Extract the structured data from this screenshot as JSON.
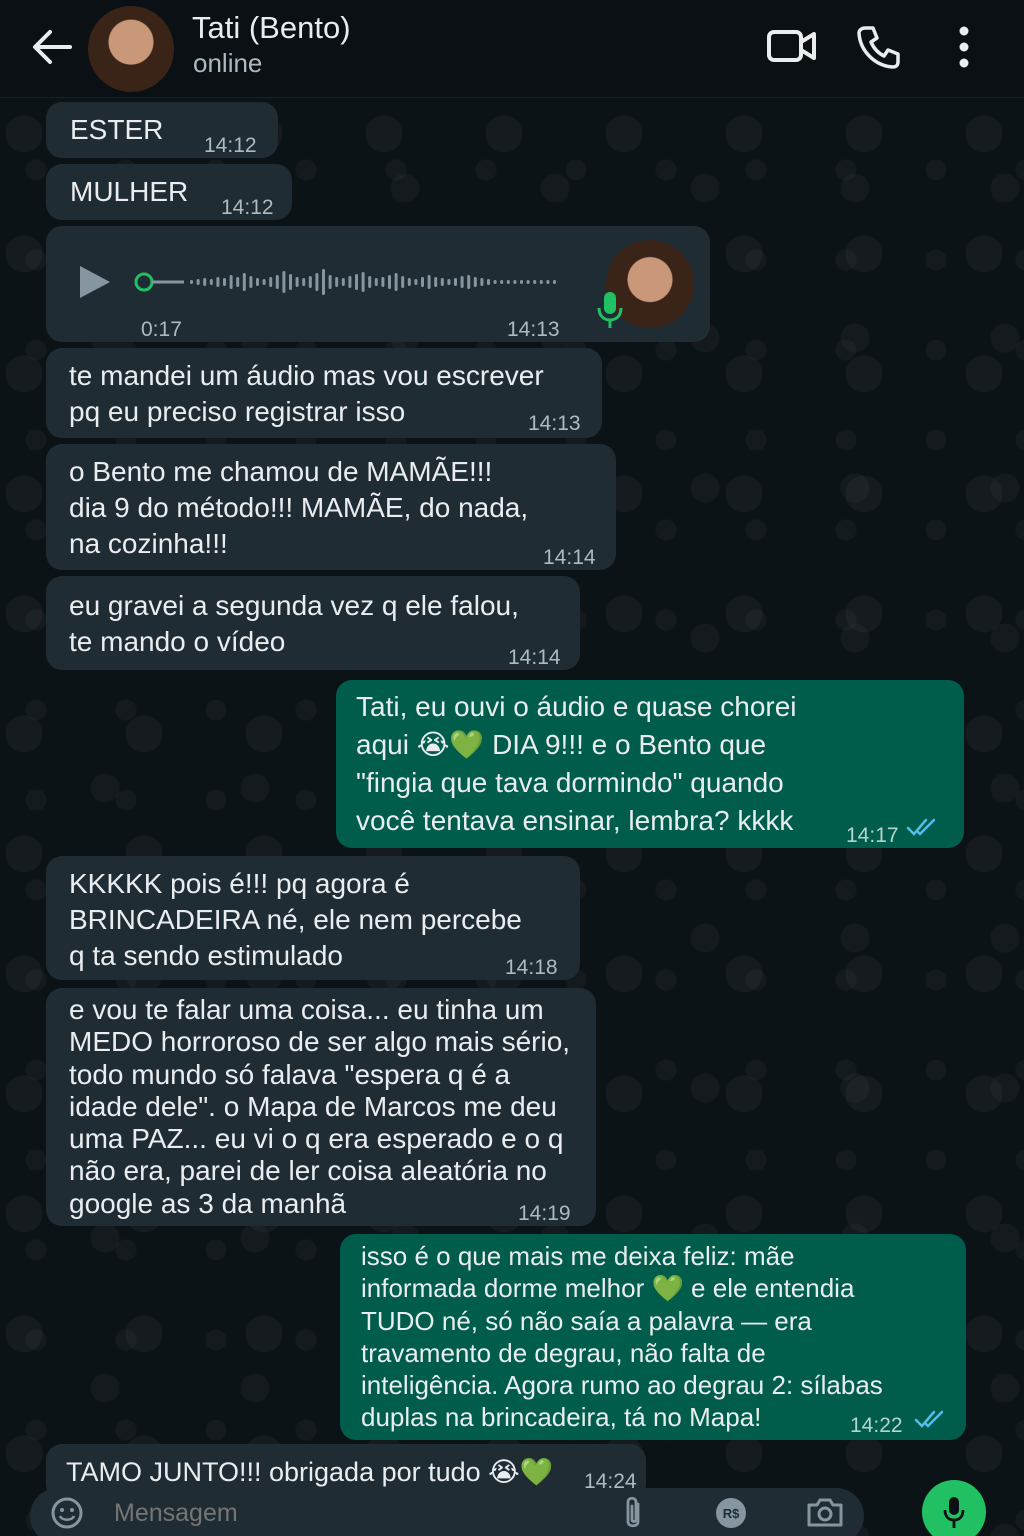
{
  "header": {
    "contact_name": "Tati (Bento)",
    "status": "online"
  },
  "messages": [
    {
      "dir": "in",
      "text": "ESTER",
      "time": "14:12"
    },
    {
      "dir": "in",
      "text": "MULHER",
      "time": "14:12"
    },
    {
      "dir": "in",
      "type": "audio",
      "duration": "0:17",
      "time": "14:13"
    },
    {
      "dir": "in",
      "text": "te mandei um áudio mas vou escrever\npq eu preciso registrar isso",
      "time": "14:13"
    },
    {
      "dir": "in",
      "text": "o Bento me chamou de MAMÃE!!!\ndia 9 do método!!! MAMÃE, do nada,\nna cozinha!!!",
      "time": "14:14"
    },
    {
      "dir": "in",
      "text": "eu gravei a segunda vez q ele falou,\nte mando o vídeo",
      "time": "14:14"
    },
    {
      "dir": "out",
      "text": "Tati, eu ouvi o áudio e quase chorei\naqui 😭💚 DIA 9!!! e o Bento que\n\"fingia que tava dormindo\" quando\nvocê tentava ensinar, lembra? kkkk",
      "time": "14:17"
    },
    {
      "dir": "in",
      "text": "KKKKK pois é!!! pq agora é\nBRINCADEIRA né, ele nem percebe\nq ta sendo estimulado",
      "time": "14:18"
    },
    {
      "dir": "in",
      "text": "e vou te falar uma coisa... eu tinha um\nMEDO horroroso de ser algo mais sério,\ntodo mundo só falava \"espera q é a\nidade dele\". o Mapa de Marcos me deu\numa PAZ... eu vi o q era esperado e o q\nnão era, parei de ler coisa aleatória no\ngoogle as 3 da manhã",
      "time": "14:19"
    },
    {
      "dir": "out",
      "text": "isso é o que mais me deixa feliz: mãe\ninformada dorme melhor 💚 e ele entendia\nTUDO né, só não saía a palavra — era\ntravamento de degrau, não falta de\ninteligência. Agora rumo ao degrau 2: sílabas\nduplas na brincadeira, tá no Mapa!",
      "time": "14:22"
    },
    {
      "dir": "in",
      "text": "TAMO JUNTO!!! obrigada por tudo 😭💚",
      "time": "14:24"
    }
  ],
  "composer": {
    "placeholder": "Mensagem"
  },
  "colors": {
    "incoming_bubble": "#202c33",
    "outgoing_bubble": "#005c4b",
    "accent_green": "#21c063",
    "read_ticks": "#53bdeb"
  }
}
